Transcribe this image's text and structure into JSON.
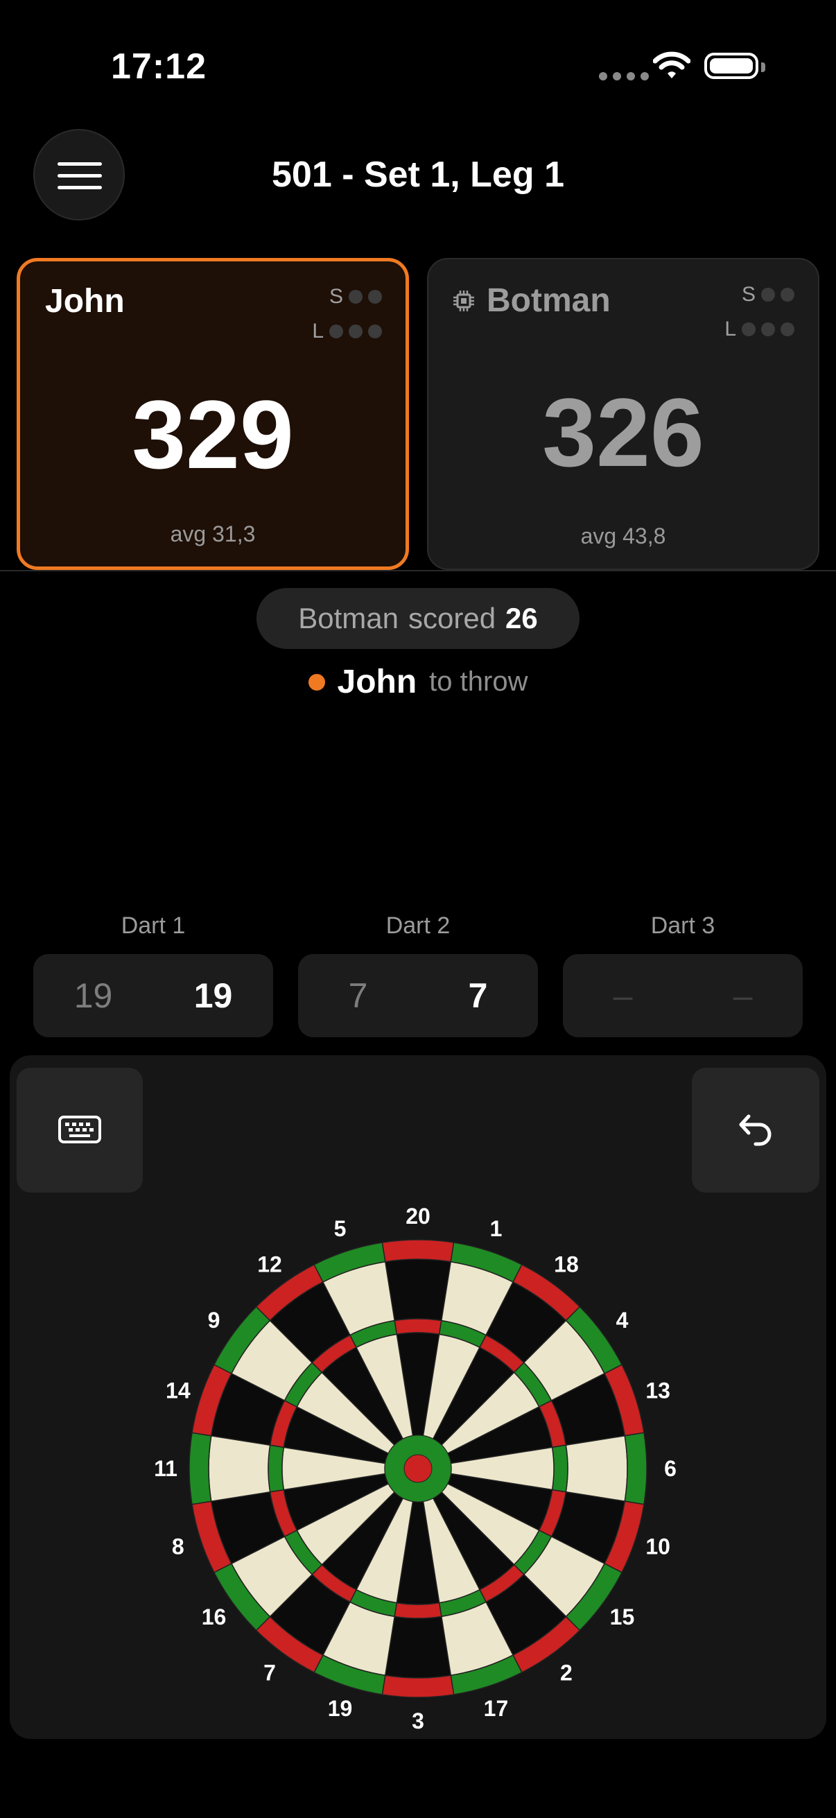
{
  "status": {
    "time": "17:12"
  },
  "header": {
    "title": "501 - Set 1, Leg 1",
    "menu_icon": "hamburger-icon"
  },
  "players": [
    {
      "name": "John",
      "score": "329",
      "avg": "avg 31,3",
      "set_label": "S",
      "leg_label": "L",
      "active": true
    },
    {
      "name": "Botman",
      "score": "326",
      "avg": "avg 43,8",
      "set_label": "S",
      "leg_label": "L",
      "active": false,
      "icon": "cpu-chip-icon"
    }
  ],
  "last_score": {
    "player": "Botman",
    "verb": "scored",
    "value": "26"
  },
  "turn": {
    "player": "John",
    "text": "to throw"
  },
  "darts": [
    {
      "label": "Dart 1",
      "raw": "19",
      "value": "19"
    },
    {
      "label": "Dart 2",
      "raw": "7",
      "value": "7"
    },
    {
      "label": "Dart 3",
      "raw": "–",
      "value": "–"
    }
  ],
  "board": {
    "numbers": [
      "20",
      "1",
      "18",
      "4",
      "13",
      "6",
      "10",
      "15",
      "2",
      "17",
      "3",
      "19",
      "7",
      "16",
      "8",
      "11",
      "14",
      "9",
      "12",
      "5"
    ]
  },
  "colors": {
    "accent": "#f07a22",
    "board_red": "#cc2222",
    "board_green": "#1f8b24",
    "board_cream": "#ece6cc",
    "board_black": "#0b0b0b"
  }
}
